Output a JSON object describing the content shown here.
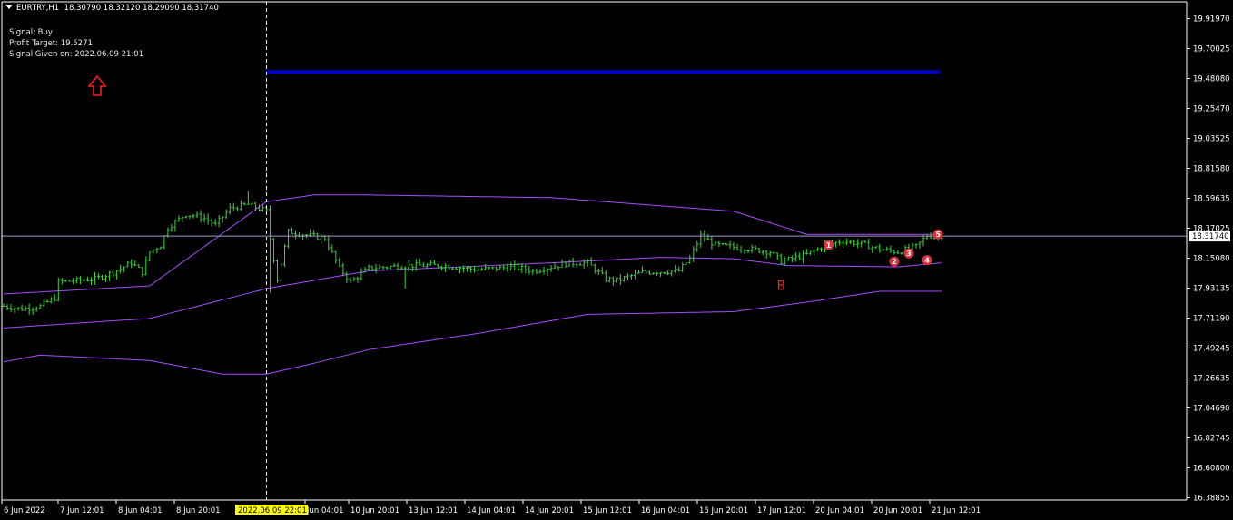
{
  "header": {
    "symbol": "EURTRY,H1",
    "ohlc": "18.30790 18.32120 18.29090 18.31740"
  },
  "signal_box": {
    "signal": "Signal: Buy",
    "target": "Profit Target: 19.5271",
    "given": "Signal Given on: 2022.06.09 21:01"
  },
  "colors": {
    "background": "#000000",
    "candles": "#39d339",
    "bands": "#a64dff",
    "target_line": "#0000cc",
    "marker": "#e0303a",
    "arrow": "#ff2020",
    "crosshair": "#ffff80",
    "axis": "#ffffff"
  },
  "chart_data": {
    "type": "bar",
    "symbol": "EURTRY",
    "timeframe": "H1",
    "y_ticks": [
      "19.91970",
      "19.70025",
      "19.48080",
      "19.25470",
      "19.03525",
      "18.81580",
      "18.59635",
      "18.37025",
      "18.15080",
      "17.93135",
      "17.71190",
      "17.49245",
      "17.26635",
      "17.04690",
      "16.82745",
      "16.60800",
      "16.38855"
    ],
    "ylim": [
      16.38855,
      19.9197
    ],
    "x_ticks": [
      "6 Jun 2022",
      "7 Jun 12:01",
      "8 Jun 04:01",
      "8 Jun 20:01",
      "2022.06.09 22:01",
      "Jun 04:01",
      "10 Jun 20:01",
      "13 Jun 12:01",
      "14 Jun 04:01",
      "14 Jun 20:01",
      "15 Jun 12:01",
      "16 Jun 04:01",
      "16 Jun 20:01",
      "17 Jun 12:01",
      "20 Jun 04:01",
      "20 Jun 20:01",
      "21 Jun 12:01"
    ],
    "current_price": "18.31740",
    "current_price_value": 18.3174,
    "profit_target": 19.5271,
    "signal_bar_label": "2022.06.09 22:01",
    "signal_index": 72,
    "bar_count": 258,
    "close_anchors": [
      [
        0,
        17.8
      ],
      [
        5,
        17.78
      ],
      [
        10,
        17.8
      ],
      [
        14,
        17.86
      ],
      [
        15,
        17.98
      ],
      [
        20,
        17.99
      ],
      [
        25,
        18.0
      ],
      [
        30,
        18.05
      ],
      [
        35,
        18.12
      ],
      [
        38,
        18.05
      ],
      [
        40,
        18.2
      ],
      [
        43,
        18.25
      ],
      [
        45,
        18.38
      ],
      [
        50,
        18.48
      ],
      [
        55,
        18.45
      ],
      [
        58,
        18.4
      ],
      [
        62,
        18.52
      ],
      [
        67,
        18.55
      ],
      [
        72,
        18.5
      ],
      [
        73,
        18.3
      ],
      [
        75,
        18.0
      ],
      [
        78,
        18.35
      ],
      [
        84,
        18.32
      ],
      [
        88,
        18.3
      ],
      [
        92,
        18.08
      ],
      [
        95,
        17.98
      ],
      [
        100,
        18.08
      ],
      [
        110,
        18.1
      ],
      [
        120,
        18.1
      ],
      [
        130,
        18.07
      ],
      [
        140,
        18.09
      ],
      [
        145,
        18.06
      ],
      [
        155,
        18.12
      ],
      [
        160,
        18.12
      ],
      [
        165,
        18.0
      ],
      [
        168,
        17.99
      ],
      [
        175,
        18.05
      ],
      [
        185,
        18.06
      ],
      [
        188,
        18.15
      ],
      [
        191,
        18.32
      ],
      [
        195,
        18.25
      ],
      [
        205,
        18.22
      ],
      [
        210,
        18.2
      ],
      [
        213,
        18.13
      ],
      [
        220,
        18.18
      ],
      [
        225,
        18.25
      ],
      [
        230,
        18.28
      ],
      [
        235,
        18.26
      ],
      [
        240,
        18.22
      ],
      [
        245,
        18.2
      ],
      [
        250,
        18.24
      ],
      [
        253,
        18.32
      ],
      [
        257,
        18.32
      ]
    ],
    "bands": {
      "upper": [
        [
          0,
          17.89
        ],
        [
          40,
          17.95
        ],
        [
          72,
          18.57
        ],
        [
          85,
          18.62
        ],
        [
          100,
          18.62
        ],
        [
          150,
          18.6
        ],
        [
          200,
          18.5
        ],
        [
          220,
          18.33
        ],
        [
          245,
          18.33
        ],
        [
          257,
          18.33
        ]
      ],
      "middle": [
        [
          0,
          17.64
        ],
        [
          40,
          17.71
        ],
        [
          72,
          17.93
        ],
        [
          100,
          18.06
        ],
        [
          150,
          18.12
        ],
        [
          180,
          18.16
        ],
        [
          200,
          18.15
        ],
        [
          215,
          18.1
        ],
        [
          245,
          18.09
        ],
        [
          257,
          18.12
        ]
      ],
      "lower": [
        [
          0,
          17.39
        ],
        [
          10,
          17.44
        ],
        [
          40,
          17.4
        ],
        [
          60,
          17.3
        ],
        [
          72,
          17.3
        ],
        [
          85,
          17.38
        ],
        [
          100,
          17.48
        ],
        [
          130,
          17.6
        ],
        [
          160,
          17.74
        ],
        [
          200,
          17.76
        ],
        [
          220,
          17.83
        ],
        [
          240,
          17.91
        ],
        [
          257,
          17.91
        ]
      ]
    },
    "markers": [
      {
        "label": "B",
        "index": 213,
        "price": 18.04
      },
      {
        "label": "1",
        "index": 226,
        "price": 18.25,
        "num": "1"
      },
      {
        "label": "2",
        "index": 244,
        "price": 18.13,
        "num": "2"
      },
      {
        "label": "3",
        "index": 248,
        "price": 18.19,
        "num": "3"
      },
      {
        "label": "4",
        "index": 253,
        "price": 18.14,
        "num": "4"
      },
      {
        "label": "5",
        "index": 256,
        "price": 18.33,
        "num": "5"
      }
    ],
    "signal_arrow": "up"
  }
}
